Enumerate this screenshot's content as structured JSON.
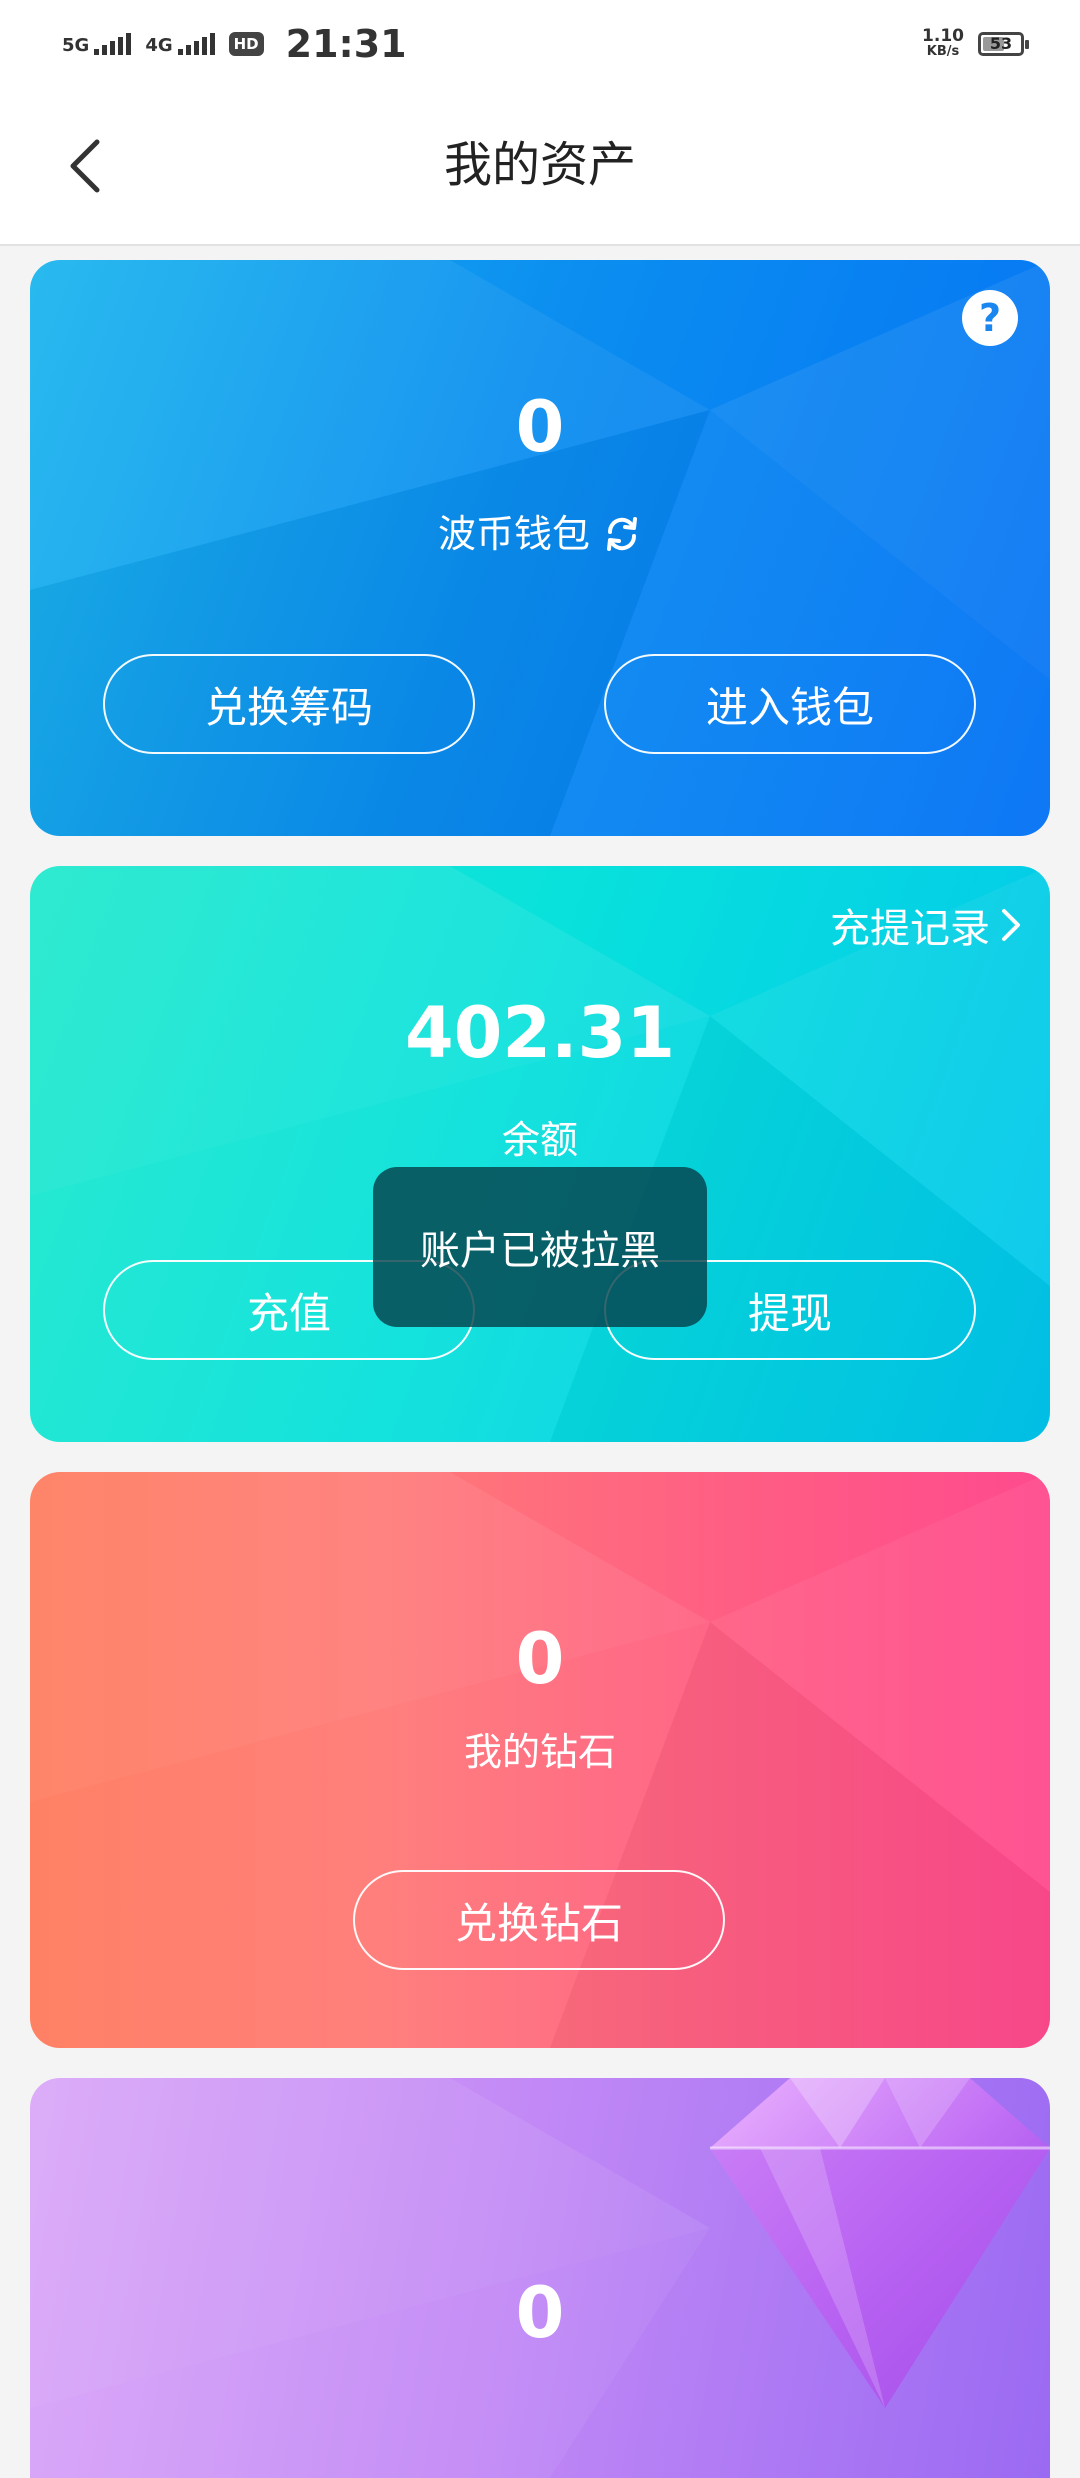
{
  "status_bar": {
    "signal_1": "5G",
    "signal_2": "4G",
    "hd_badge": "HD",
    "time": "21:31",
    "net_speed_value": "1.10",
    "net_speed_unit": "KB/s",
    "battery_level": "53"
  },
  "header": {
    "title": "我的资产",
    "back_icon": "chevron-left-icon"
  },
  "bocoin_card": {
    "amount": "0",
    "label": "波币钱包",
    "refresh_icon": "refresh-icon",
    "help_symbol": "?",
    "exchange_button": "兑换筹码",
    "wallet_button": "进入钱包"
  },
  "balance_card": {
    "record_link": "充提记录",
    "amount": "402.31",
    "label": "余额",
    "recharge_button": "充值",
    "withdraw_button": "提现"
  },
  "diamond_card": {
    "amount": "0",
    "label": "我的钻石",
    "exchange_button": "兑换钻石"
  },
  "purple_card": {
    "amount": "0",
    "decoration_icon": "diamond-icon"
  },
  "toast": {
    "message": "账户已被拉黑"
  },
  "colors": {
    "blue_card": "#0b8ef0",
    "cyan_card": "#08e1dc",
    "coral_card": "#ff6e7c",
    "purple_card": "#c38af6",
    "toast_bg": "#053e48"
  }
}
